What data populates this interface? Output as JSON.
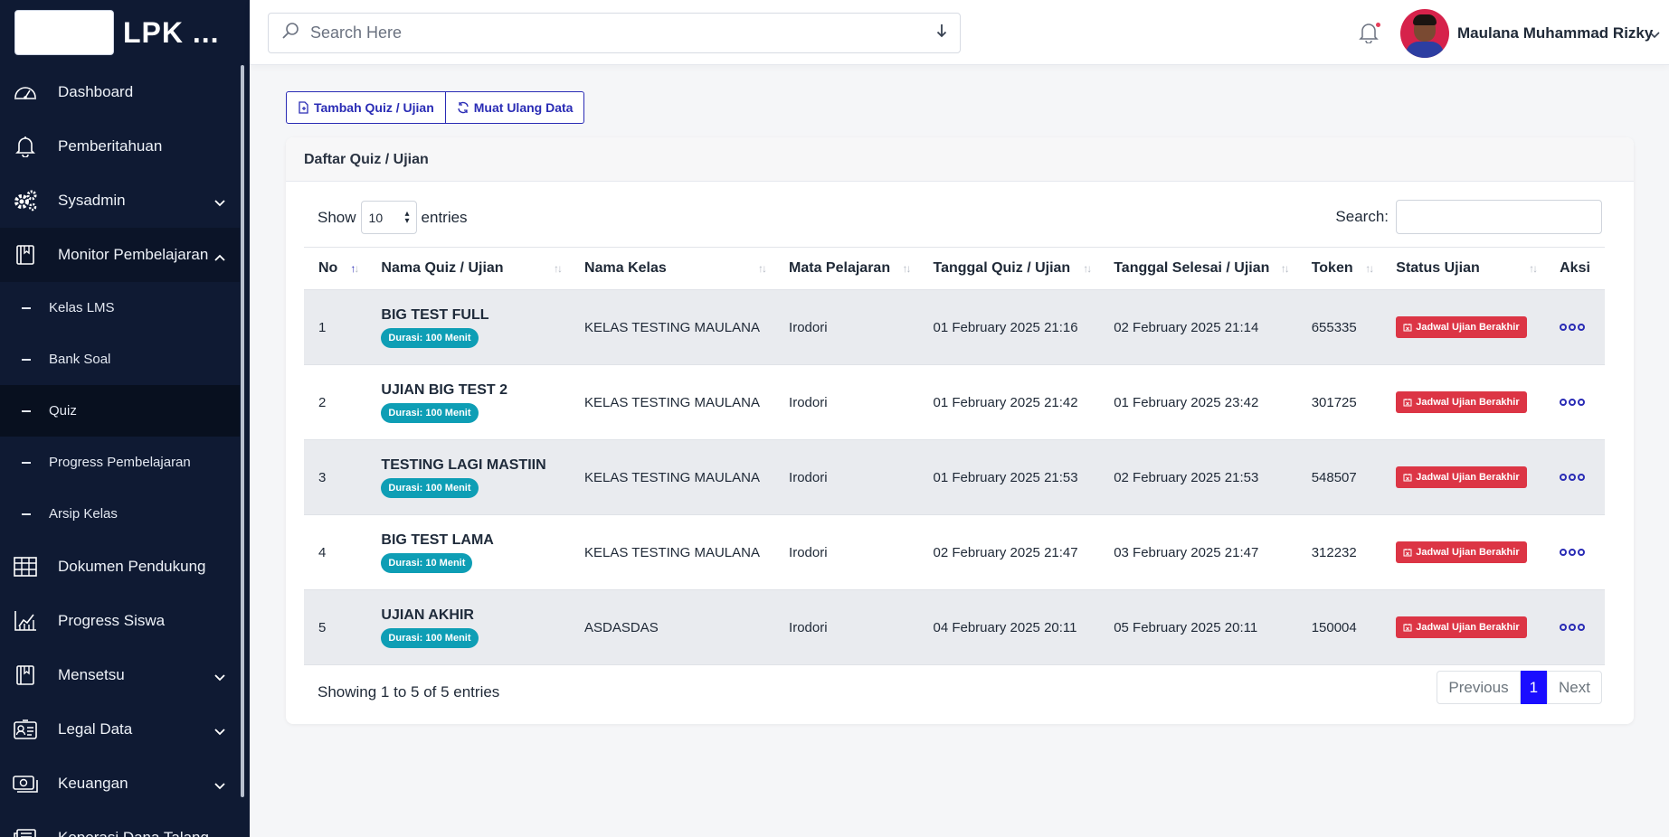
{
  "brand": {
    "title": "LPK ..."
  },
  "sidebar": {
    "items": [
      {
        "label": "Dashboard",
        "icon": "gauge-icon"
      },
      {
        "label": "Pemberitahuan",
        "icon": "bell-icon"
      },
      {
        "label": "Sysadmin",
        "icon": "gears-icon"
      },
      {
        "label": "Monitor Pembelajaran",
        "icon": "book-icon"
      }
    ],
    "sub_items": [
      {
        "label": "Kelas LMS"
      },
      {
        "label": "Bank Soal"
      },
      {
        "label": "Quiz",
        "active": true
      },
      {
        "label": "Progress Pembelajaran"
      },
      {
        "label": "Arsip Kelas"
      }
    ],
    "items_after": [
      {
        "label": "Dokumen Pendukung",
        "icon": "table-icon"
      },
      {
        "label": "Progress Siswa",
        "icon": "chart-icon"
      },
      {
        "label": "Mensetsu",
        "icon": "book-icon"
      },
      {
        "label": "Legal Data",
        "icon": "id-card-icon"
      },
      {
        "label": "Keuangan",
        "icon": "money-icon"
      },
      {
        "label": "Koperasi Dana Talang",
        "icon": "newspaper-icon"
      }
    ]
  },
  "topbar": {
    "search_placeholder": "Search Here",
    "user_name": "Maulana Muhammad Rizky"
  },
  "actions": {
    "add_label": "Tambah Quiz / Ujian",
    "reload_label": "Muat Ulang Data"
  },
  "card": {
    "title": "Daftar Quiz / Ujian",
    "show_label": "Show",
    "entries_label": "entries",
    "page_size": "10",
    "search_label": "Search:",
    "info": "Showing 1 to 5 of 5 entries",
    "prev_label": "Previous",
    "current_page": "1",
    "next_label": "Next"
  },
  "table": {
    "headers": [
      "No",
      "Nama Quiz / Ujian",
      "Nama Kelas",
      "Mata Pelajaran",
      "Tanggal Quiz / Ujian",
      "Tanggal Selesai / Ujian",
      "Token",
      "Status Ujian",
      "Aksi"
    ],
    "rows": [
      {
        "no": "1",
        "name": "BIG TEST FULL",
        "duration": "Durasi: 100 Menit",
        "kelas": "KELAS TESTING MAULANA",
        "mapel": "Irodori",
        "start": "01 February 2025 21:16",
        "end": "02 February 2025 21:14",
        "token": "655335",
        "status": "Jadwal Ujian Berakhir"
      },
      {
        "no": "2",
        "name": "UJIAN BIG TEST 2",
        "duration": "Durasi: 100 Menit",
        "kelas": "KELAS TESTING MAULANA",
        "mapel": "Irodori",
        "start": "01 February 2025 21:42",
        "end": "01 February 2025 23:42",
        "token": "301725",
        "status": "Jadwal Ujian Berakhir"
      },
      {
        "no": "3",
        "name": "TESTING LAGI MASTIIN",
        "duration": "Durasi: 100 Menit",
        "kelas": "KELAS TESTING MAULANA",
        "mapel": "Irodori",
        "start": "01 February 2025 21:53",
        "end": "02 February 2025 21:53",
        "token": "548507",
        "status": "Jadwal Ujian Berakhir"
      },
      {
        "no": "4",
        "name": "BIG TEST LAMA",
        "duration": "Durasi: 10 Menit",
        "kelas": "KELAS TESTING MAULANA",
        "mapel": "Irodori",
        "start": "02 February 2025 21:47",
        "end": "03 February 2025 21:47",
        "token": "312232",
        "status": "Jadwal Ujian Berakhir"
      },
      {
        "no": "5",
        "name": "UJIAN AKHIR",
        "duration": "Durasi: 100 Menit",
        "kelas": "ASDASDAS",
        "mapel": "Irodori",
        "start": "04 February 2025 20:11",
        "end": "05 February 2025 20:11",
        "token": "150004",
        "status": "Jadwal Ujian Berakhir"
      }
    ]
  },
  "colors": {
    "sidebar_bg": "#0f1a33",
    "accent": "#2a2cb5",
    "badge_duration": "#0e9eb5",
    "badge_status": "#dc3545",
    "page_active": "#1a0dff"
  }
}
